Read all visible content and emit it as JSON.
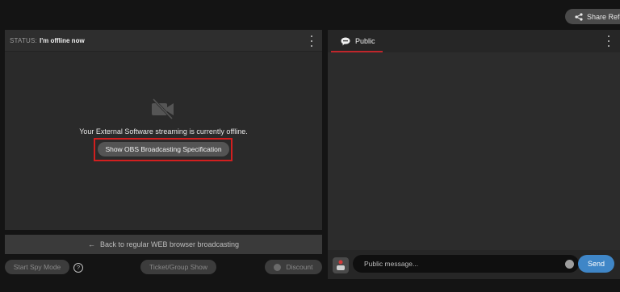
{
  "header": {
    "share_label": "Share Refe",
    "icons": {
      "share": "share-icon"
    }
  },
  "stream_panel": {
    "status_label": "STATUS:",
    "status_value": "I'm offline now",
    "camera_icon": "camera-off-icon",
    "offline_message": "Your External Software streaming is currently offline.",
    "spec_button": "Show OBS Broadcasting Specification",
    "highlight_color": "#d21f1f"
  },
  "back_bar": {
    "label": "Back to regular WEB browser broadcasting",
    "icon": "arrow-left-icon"
  },
  "bottom_controls": {
    "spy_mode": "Start Spy Mode",
    "help_glyph": "?",
    "ticket_show": "Ticket/Group Show",
    "discount": "Discount",
    "discount_icon": "discount-icon"
  },
  "chat_panel": {
    "tab_public": "Public",
    "tab_icon": "chat-bubble-icon",
    "accent_color": "#c0262b",
    "input_placeholder": "Public message...",
    "send_label": "Send",
    "send_color": "#3f86c7",
    "emoji_icon": "emoji-icon",
    "avatar_icon": "avatar-icon"
  }
}
